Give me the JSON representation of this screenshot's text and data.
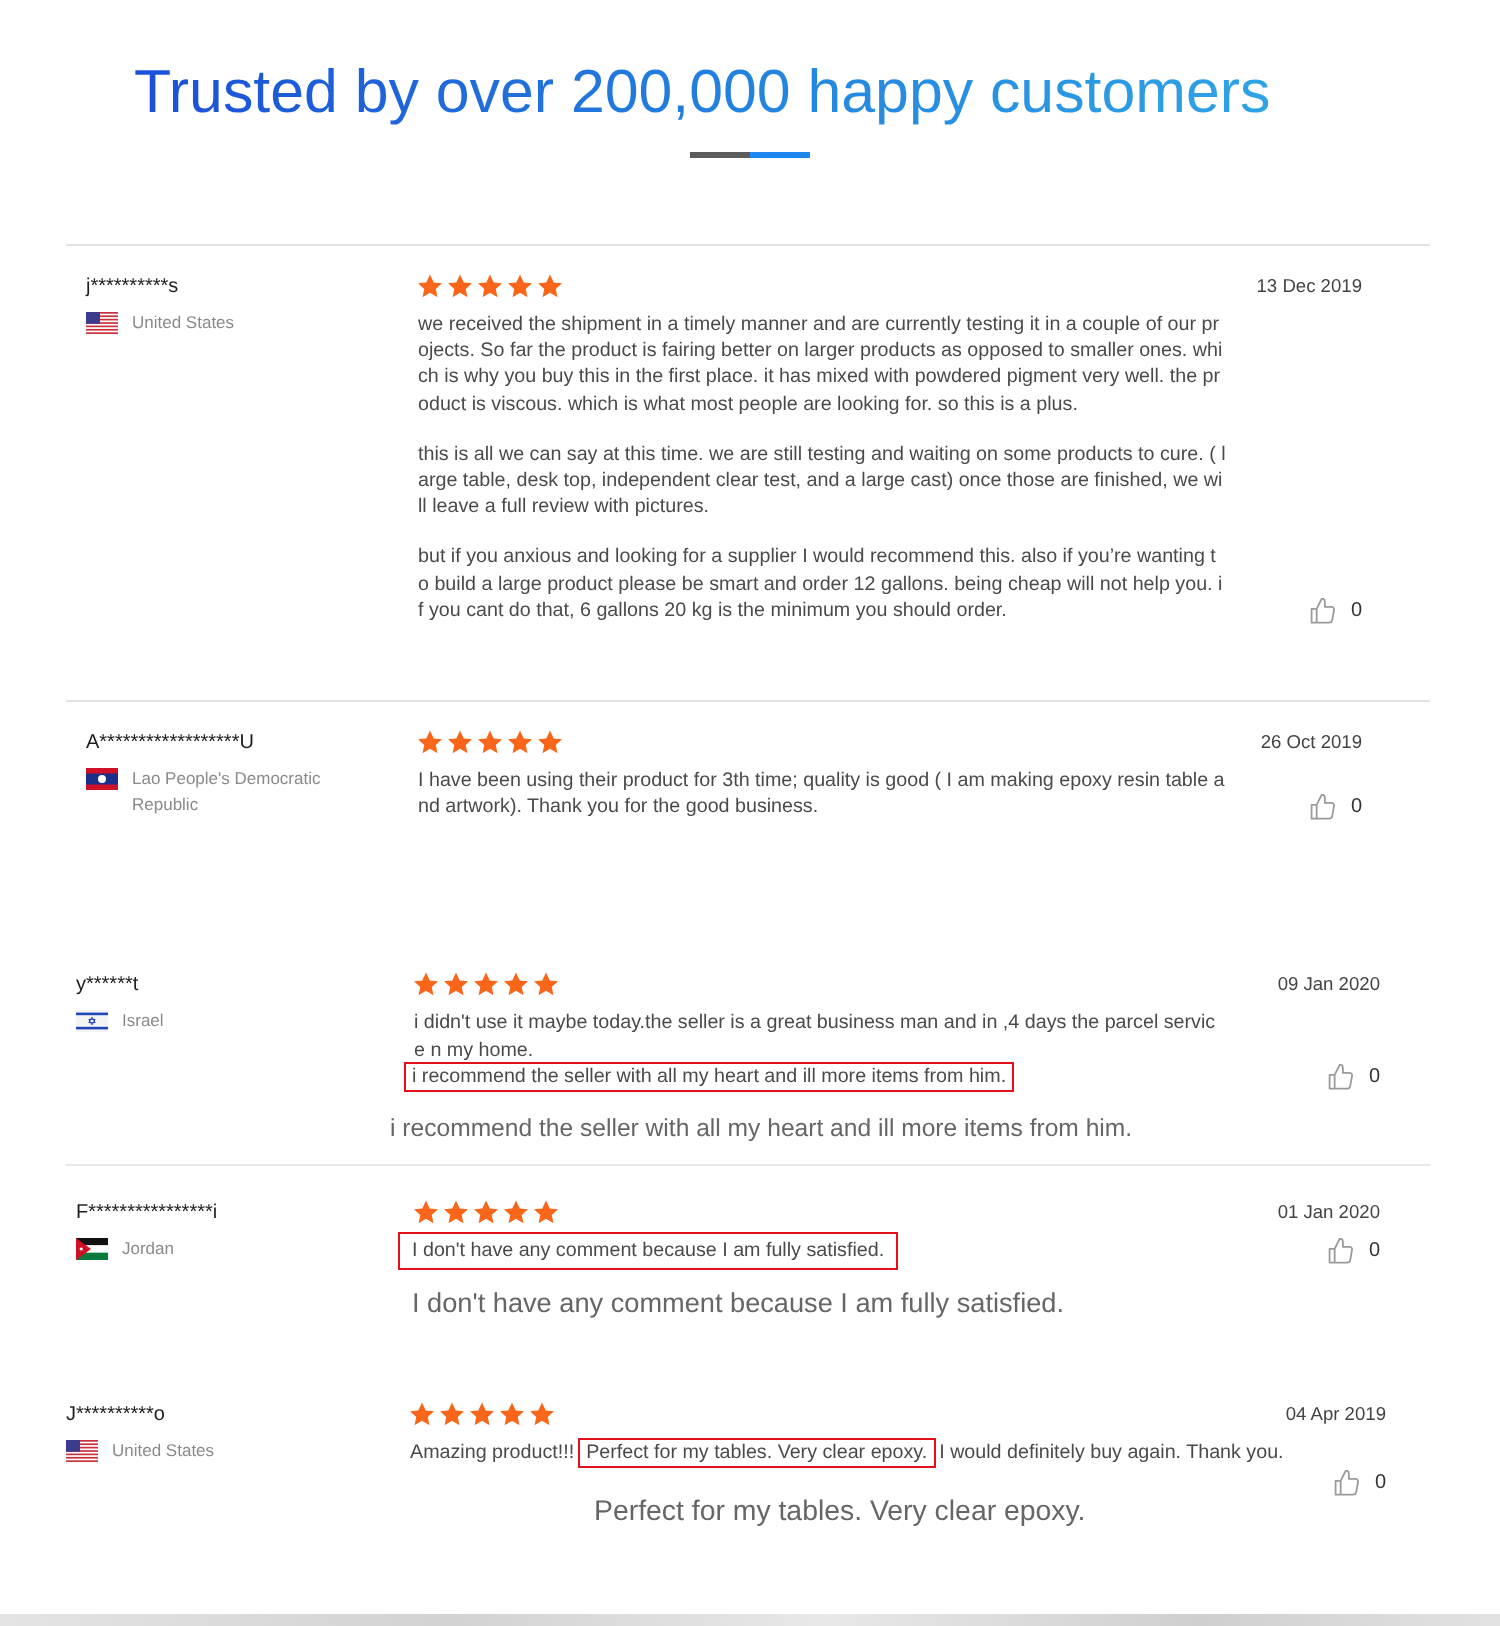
{
  "heading": {
    "title": "Trusted by over 200,000 happy customers"
  },
  "reviews": [
    {
      "reviewer": "j**********s",
      "flag": {
        "kind": "us"
      },
      "country": "United States",
      "stars": 5,
      "paragraphs": [
        [
          {
            "text": "we received the shipment in a timely manner and are currently testing it in a couple of our projects. So far the product is fairing better on larger products as opposed to smaller ones. which is why you buy this in the first place. it has mixed with powdered pigment very well. the product is viscous. which is what most people are looking for. so this is a plus.",
            "highlighted": false
          }
        ],
        [
          {
            "text": "this is all we can say at this time. we are still testing and waiting on some products to cure. ( large table, desk top, independent clear test, and a large cast) once those are finished, we will leave a full review with pictures.",
            "highlighted": false
          }
        ],
        [
          {
            "text": "but if you anxious and looking for a supplier I would recommend this. also if you’re wanting to build a large product please be smart and order 12 gallons. being cheap will not help you. if you cant do that, 6 gallons 20 kg is the minimum you should order.",
            "highlighted": false
          }
        ]
      ],
      "date": "13 Dec 2019",
      "likes": "0"
    },
    {
      "reviewer": "A******************U",
      "flag": {
        "kind": "la"
      },
      "country": "Lao People's Democratic Republic",
      "stars": 5,
      "paragraphs": [
        [
          {
            "text": "I have been using their product for 3th time; quality is good ( I am making epoxy resin table and artwork). Thank you for the good business.",
            "highlighted": false
          }
        ]
      ],
      "date": "26 Oct 2019",
      "likes": "0"
    },
    {
      "reviewer": "y******t",
      "flag": {
        "kind": "il"
      },
      "country": "Israel",
      "stars": 5,
      "paragraphs": [
        [
          {
            "text": "i didn't use it maybe today.the seller is a great business man and in ,4 days the parcel service n my home.",
            "highlighted": false
          }
        ],
        [
          {
            "text": "i recommend the seller with all my heart and ill more items from him.",
            "highlighted": true
          }
        ]
      ],
      "date": "09 Jan 2020",
      "likes": "0",
      "callout": "i recommend the seller with all my heart and ill more items from him."
    },
    {
      "reviewer": "F****************i",
      "flag": {
        "kind": "jo"
      },
      "country": "Jordan",
      "stars": 5,
      "paragraphs": [
        [
          {
            "text": "I don't have any comment because I am fully satisfied.",
            "highlighted": true
          }
        ]
      ],
      "date": "01 Jan 2020",
      "likes": "0",
      "callout": "I don't have any comment because I am fully satisfied."
    },
    {
      "reviewer": "J**********o",
      "flag": {
        "kind": "us"
      },
      "country": "United States",
      "stars": 5,
      "paragraphs": [
        [
          {
            "text": "Amazing product!!!",
            "highlighted": false
          },
          {
            "text": "Perfect for my tables. Very clear epoxy.",
            "highlighted": true
          },
          {
            "text": "I would definitely buy again. Thank you.",
            "highlighted": false
          }
        ]
      ],
      "date": "04 Apr 2019",
      "likes": "0",
      "callout": "Perfect for my tables. Very clear epoxy."
    }
  ]
}
